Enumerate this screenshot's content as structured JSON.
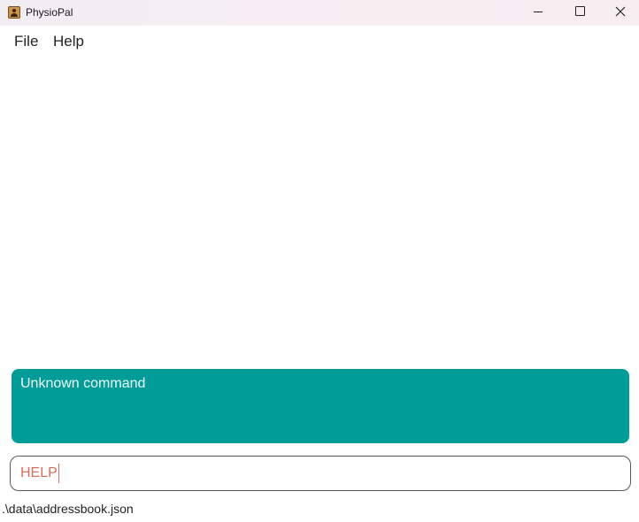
{
  "window": {
    "title": "PhysioPal"
  },
  "menu": {
    "file": "File",
    "help": "Help"
  },
  "result_display": {
    "text": "Unknown command",
    "color": "#009d98"
  },
  "command_box": {
    "value": "HELP",
    "text_color": "#d8705a"
  },
  "status_bar": {
    "path": ".\\data\\addressbook.json"
  }
}
